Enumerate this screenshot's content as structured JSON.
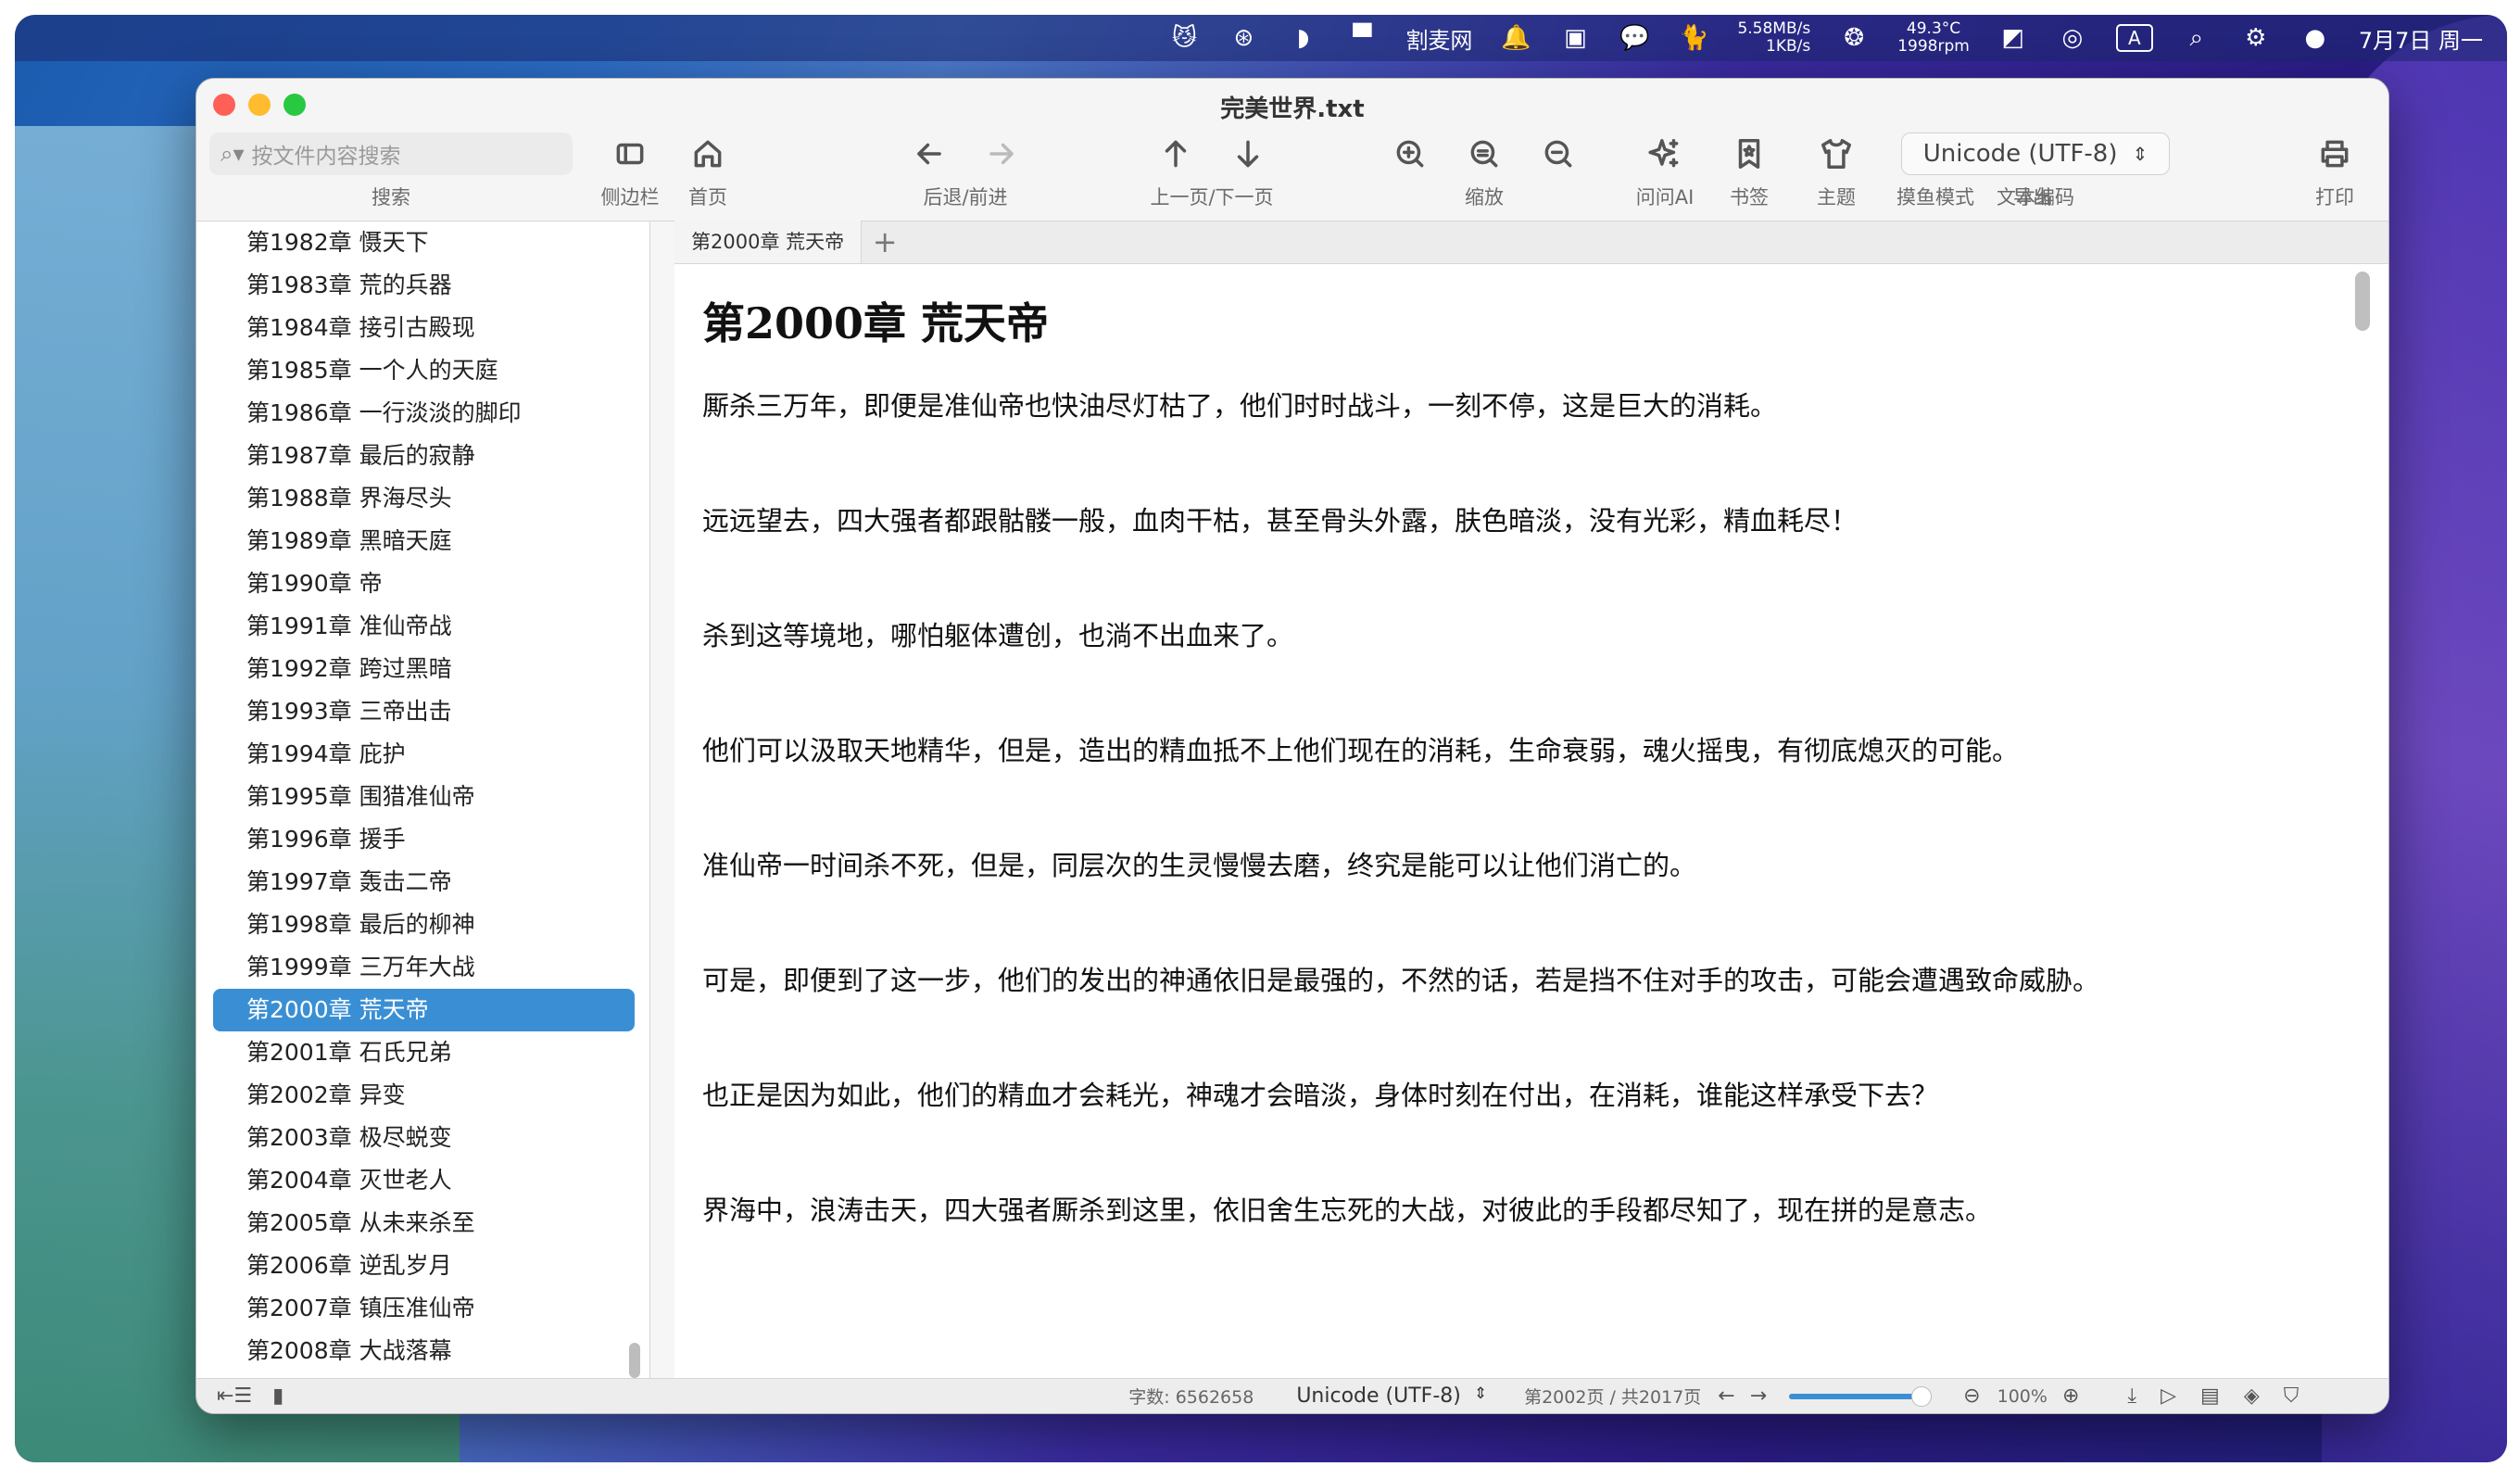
{
  "menubar": {
    "app_item": "割麦网",
    "net_up": "5.58MB/s",
    "net_down": "1KB/s",
    "temp": "49.3°C",
    "rpm": "1998rpm",
    "input_label": "A",
    "clock": "7月7日 周一"
  },
  "window": {
    "title": "完美世界.txt"
  },
  "toolbar": {
    "search_placeholder": "按文件内容搜索",
    "search_label": "搜索",
    "sidebar_label": "侧边栏",
    "home_label": "首页",
    "backforward_label": "后退/前进",
    "updown_label": "上一页/下一页",
    "zoom_label": "缩放",
    "ai_label": "问问AI",
    "bookmark_label": "书签",
    "theme_label": "主题",
    "fish_label": "摸鱼模式",
    "export_label": "导出",
    "encoding_value": "Unicode (UTF-8)",
    "encoding_label": "文本编码",
    "print_label": "打印"
  },
  "sidebar": {
    "chapters": [
      "第1982章 慑天下",
      "第1983章 荒的兵器",
      "第1984章 接引古殿现",
      "第1985章 一个人的天庭",
      "第1986章 一行淡淡的脚印",
      "第1987章 最后的寂静",
      "第1988章 界海尽头",
      "第1989章 黑暗天庭",
      "第1990章 帝",
      "第1991章 准仙帝战",
      "第1992章 跨过黑暗",
      "第1993章 三帝出击",
      "第1994章 庇护",
      "第1995章 围猎准仙帝",
      "第1996章 援手",
      "第1997章 轰击二帝",
      "第1998章 最后的柳神",
      "第1999章 三万年大战",
      "第2000章 荒天帝",
      "第2001章 石氏兄弟",
      "第2002章 异变",
      "第2003章 极尽蜕变",
      "第2004章 灭世老人",
      "第2005章 从未来杀至",
      "第2006章 逆乱岁月",
      "第2007章 镇压准仙帝",
      "第2008章 大战落幕"
    ],
    "selected_index": 18
  },
  "tabs": [
    {
      "label": "第2000章 荒天帝"
    }
  ],
  "reader": {
    "title": "第2000章 荒天帝",
    "paragraphs": [
      "厮杀三万年，即便是准仙帝也快油尽灯枯了，他们时时战斗，一刻不停，这是巨大的消耗。",
      "远远望去，四大强者都跟骷髅一般，血肉干枯，甚至骨头外露，肤色暗淡，没有光彩，精血耗尽！",
      "杀到这等境地，哪怕躯体遭创，也淌不出血来了。",
      "他们可以汲取天地精华，但是，造出的精血抵不上他们现在的消耗，生命衰弱，魂火摇曳，有彻底熄灭的可能。",
      "准仙帝一时间杀不死，但是，同层次的生灵慢慢去磨，终究是能可以让他们消亡的。",
      "可是，即便到了这一步，他们的发出的神通依旧是最强的，不然的话，若是挡不住对手的攻击，可能会遭遇致命威胁。",
      "也正是因为如此，他们的精血才会耗光，神魂才会暗淡，身体时刻在付出，在消耗，谁能这样承受下去？",
      "界海中，浪涛击天，四大强者厮杀到这里，依旧舍生忘死的大战，对彼此的手段都尽知了，现在拼的是意志。"
    ]
  },
  "statusbar": {
    "char_count": "字数: 6562658",
    "encoding": "Unicode (UTF-8)",
    "page_info": "第2002页 / 共2017页",
    "zoom": "100%",
    "zoom_fraction": 0.95
  }
}
